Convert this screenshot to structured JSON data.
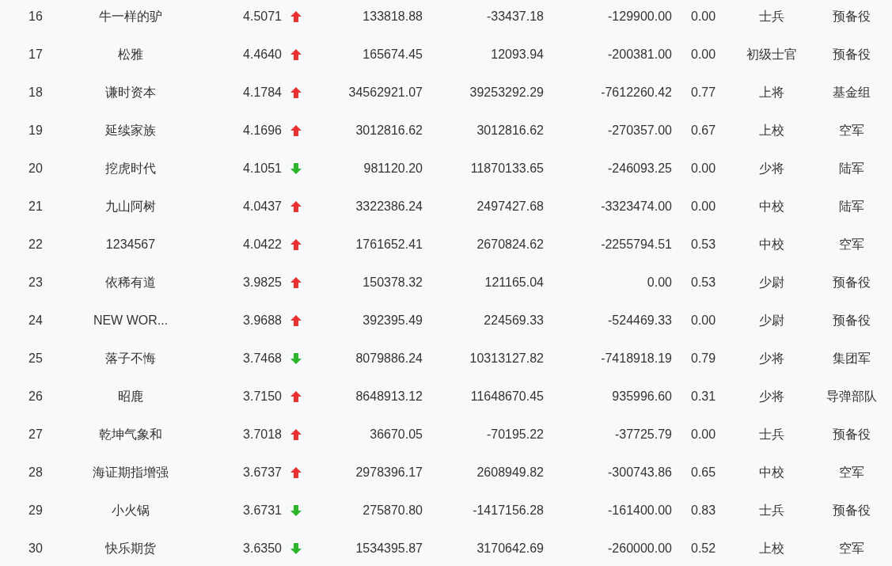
{
  "table": {
    "rows": [
      {
        "cells": [
          "16",
          "牛一样的驴",
          "4.5071",
          "133818.88",
          "-33437.18",
          "-129900.00",
          "0.00",
          "士兵",
          "预备役"
        ],
        "kind": "up"
      },
      {
        "cells": [
          "17",
          "松雅",
          "4.4640",
          "165674.45",
          "12093.94",
          "-200381.00",
          "0.00",
          "初级士官",
          "预备役"
        ],
        "kind": "up"
      },
      {
        "cells": [
          "18",
          "谦时资本",
          "4.1784",
          "34562921.07",
          "39253292.29",
          "-7612260.42",
          "0.77",
          "上将",
          "基金组"
        ],
        "kind": "up"
      },
      {
        "cells": [
          "19",
          "延续家族",
          "4.1696",
          "3012816.62",
          "3012816.62",
          "-270357.00",
          "0.67",
          "上校",
          "空军"
        ],
        "kind": "up"
      },
      {
        "cells": [
          "20",
          "挖虎时代",
          "4.1051",
          "981120.20",
          "11870133.65",
          "-246093.25",
          "0.00",
          "少将",
          "陆军"
        ],
        "kind": "down"
      },
      {
        "cells": [
          "21",
          "九山阿树",
          "4.0437",
          "3322386.24",
          "2497427.68",
          "-3323474.00",
          "0.00",
          "中校",
          "陆军"
        ],
        "kind": "up"
      },
      {
        "cells": [
          "22",
          "1234567",
          "4.0422",
          "1761652.41",
          "2670824.62",
          "-2255794.51",
          "0.53",
          "中校",
          "空军"
        ],
        "kind": "up"
      },
      {
        "cells": [
          "23",
          "依稀有道",
          "3.9825",
          "150378.32",
          "121165.04",
          "0.00",
          "0.53",
          "少尉",
          "预备役"
        ],
        "kind": "up"
      },
      {
        "cells": [
          "24",
          "NEW WOR...",
          "3.9688",
          "392395.49",
          "224569.33",
          "-524469.33",
          "0.00",
          "少尉",
          "预备役"
        ],
        "kind": "up"
      },
      {
        "cells": [
          "25",
          "落子不悔",
          "3.7468",
          "8079886.24",
          "10313127.82",
          "-7418918.19",
          "0.79",
          "少将",
          "集团军"
        ],
        "kind": "down"
      },
      {
        "cells": [
          "26",
          "昭鹿",
          "3.7150",
          "8648913.12",
          "11648670.45",
          "935996.60",
          "0.31",
          "少将",
          "导弹部队"
        ],
        "kind": "up"
      },
      {
        "cells": [
          "27",
          "乾坤气象和",
          "3.7018",
          "36670.05",
          "-70195.22",
          "-37725.79",
          "0.00",
          "士兵",
          "预备役"
        ],
        "kind": "up"
      },
      {
        "cells": [
          "28",
          "海证期指增强",
          "3.6737",
          "2978396.17",
          "2608949.82",
          "-300743.86",
          "0.65",
          "中校",
          "空军"
        ],
        "kind": "up"
      },
      {
        "cells": [
          "29",
          "小火锅",
          "3.6731",
          "275870.80",
          "-1417156.28",
          "-161400.00",
          "0.83",
          "士兵",
          "预备役"
        ],
        "kind": "down"
      },
      {
        "cells": [
          "30",
          "快乐期货",
          "3.6350",
          "1534395.87",
          "3170642.69",
          "-260000.00",
          "0.52",
          "上校",
          "空军"
        ],
        "kind": "down"
      }
    ]
  }
}
